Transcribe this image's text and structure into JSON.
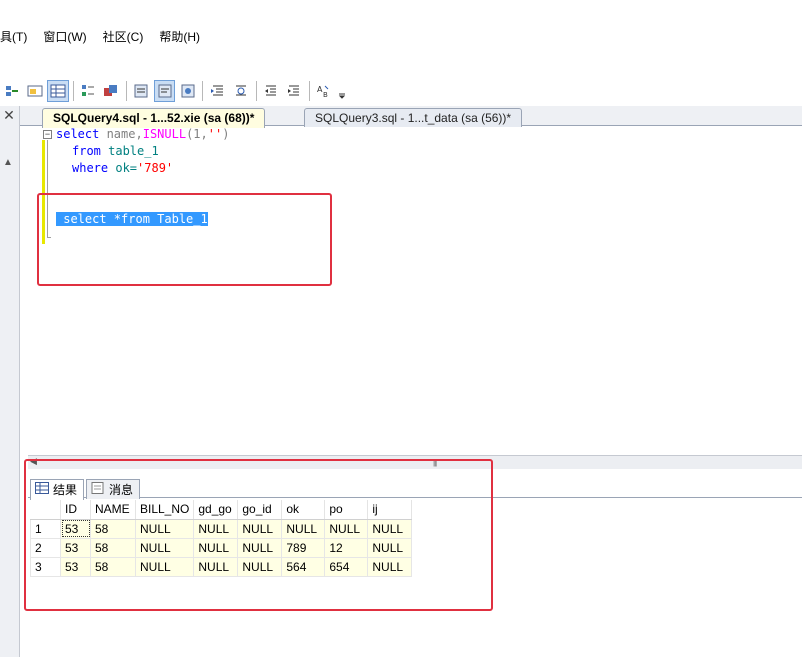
{
  "menu": {
    "items": [
      "具(T)",
      "窗口(W)",
      "社区(C)",
      "帮助(H)"
    ]
  },
  "toolbar": {
    "icons": [
      "query-options-icon",
      "include-plan-icon",
      "results-to-grid-icon",
      "results-to-text-icon",
      "results-to-file-icon",
      "comment-icon",
      "uncomment-icon",
      "specify-values-icon",
      "decrease-indent-icon",
      "increase-indent-icon",
      "outdent-icon",
      "indent-icon",
      "change-case-icon",
      "overflow-icon"
    ]
  },
  "tabs": {
    "active": "SQLQuery4.sql - 1...52.xie (sa (68))*",
    "inactive": "SQLQuery3.sql - 1...t_data (sa (56))*"
  },
  "editor": {
    "line1": {
      "kw1": "select",
      "text1": " name,",
      "fn": "ISNULL",
      "text2": "(1,",
      "str": "''",
      "text3": ")"
    },
    "line2": {
      "kw": "from",
      "text": " table_1"
    },
    "line3": {
      "kw": "where",
      "text": " ok=",
      "str": "'789'"
    },
    "line5": " select *from Table_1"
  },
  "results": {
    "tab_results": "结果",
    "tab_messages": "消息",
    "columns": [
      "ID",
      "NAME",
      "BILL_NO",
      "gd_go",
      "go_id",
      "ok",
      "po",
      "ij"
    ],
    "rows": [
      [
        "1",
        "53",
        "58",
        "NULL",
        "NULL",
        "NULL",
        "NULL",
        "NULL",
        "NULL"
      ],
      [
        "2",
        "53",
        "58",
        "NULL",
        "NULL",
        "NULL",
        "789",
        "12",
        "NULL"
      ],
      [
        "3",
        "53",
        "58",
        "NULL",
        "NULL",
        "NULL",
        "564",
        "654",
        "NULL"
      ]
    ]
  },
  "colors": {
    "annotation_red": "#e03040",
    "selection_blue": "#3399ff",
    "keyword_blue": "#0000ff",
    "function_magenta": "#ff00ff",
    "string_red": "#ff0000"
  }
}
